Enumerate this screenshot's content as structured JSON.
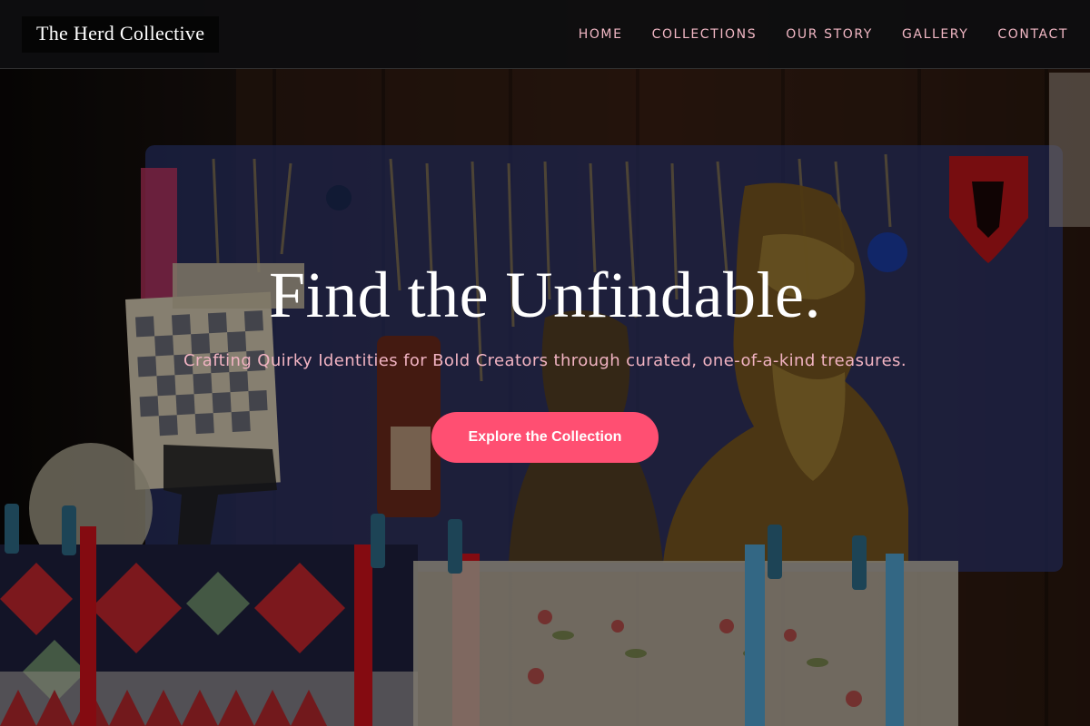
{
  "header": {
    "brand": "The Herd Collective",
    "nav": [
      {
        "label": "HOME"
      },
      {
        "label": "COLLECTIONS"
      },
      {
        "label": "OUR STORY"
      },
      {
        "label": "GALLERY"
      },
      {
        "label": "CONTACT"
      }
    ]
  },
  "hero": {
    "title": "Find the Unfindable.",
    "subtitle": "Crafting Quirky Identities for Bold Creators through curated, one-of-a-kind treasures.",
    "cta_label": "Explore the Collection",
    "background_image": "market-stall-photo"
  },
  "colors": {
    "accent": "#ff4f72",
    "nav_text": "#f1b7c4",
    "subtitle_text": "#f1b3c2",
    "header_bg": "#0e0e10",
    "brand_bg": "#050505"
  }
}
